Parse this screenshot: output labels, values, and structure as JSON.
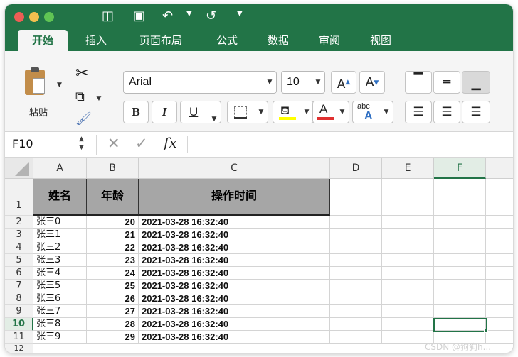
{
  "titlebar": {
    "icons": [
      "sidebar-icon",
      "save-icon",
      "undo-icon",
      "redo-icon",
      "customize-icon"
    ],
    "colors": {
      "excel_green": "#227447"
    }
  },
  "tabs": [
    {
      "label": "开始",
      "active": true
    },
    {
      "label": "插入"
    },
    {
      "label": "页面布局"
    },
    {
      "label": "公式"
    },
    {
      "label": "数据"
    },
    {
      "label": "审阅"
    },
    {
      "label": "视图"
    }
  ],
  "ribbon": {
    "paste_label": "粘贴",
    "font_name": "Arial",
    "font_size": "10",
    "grow_font": "A",
    "shrink_font": "A",
    "bold": "B",
    "italic": "I",
    "underline": "U",
    "wrap_label": "abc",
    "highlight_color": "#ffff00",
    "font_color": "#e03030"
  },
  "formula_bar": {
    "name_box": "F10",
    "formula": "",
    "fx": "fx"
  },
  "grid": {
    "columns": [
      "A",
      "B",
      "C",
      "D",
      "E",
      "F"
    ],
    "selected_column": "F",
    "selected_row": "10",
    "header_row": {
      "row": "1",
      "a": "姓名",
      "b": "年龄",
      "c": "操作时间"
    },
    "rows": [
      {
        "row": "2",
        "a": "张三0",
        "b": "20",
        "c": "2021-03-28 16:32:40"
      },
      {
        "row": "3",
        "a": "张三1",
        "b": "21",
        "c": "2021-03-28 16:32:40"
      },
      {
        "row": "4",
        "a": "张三2",
        "b": "22",
        "c": "2021-03-28 16:32:40"
      },
      {
        "row": "5",
        "a": "张三3",
        "b": "23",
        "c": "2021-03-28 16:32:40"
      },
      {
        "row": "6",
        "a": "张三4",
        "b": "24",
        "c": "2021-03-28 16:32:40"
      },
      {
        "row": "7",
        "a": "张三5",
        "b": "25",
        "c": "2021-03-28 16:32:40"
      },
      {
        "row": "8",
        "a": "张三6",
        "b": "26",
        "c": "2021-03-28 16:32:40"
      },
      {
        "row": "9",
        "a": "张三7",
        "b": "27",
        "c": "2021-03-28 16:32:40"
      },
      {
        "row": "10",
        "a": "张三8",
        "b": "28",
        "c": "2021-03-28 16:32:40"
      },
      {
        "row": "11",
        "a": "张三9",
        "b": "29",
        "c": "2021-03-28 16:32:40"
      }
    ],
    "next_row": "12"
  },
  "watermark": "CSDN @狗狗h..."
}
